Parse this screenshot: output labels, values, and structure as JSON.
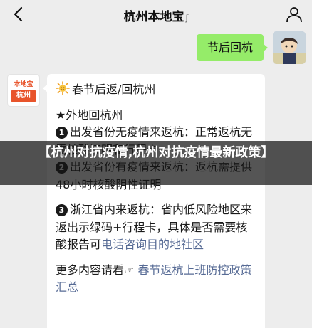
{
  "nav": {
    "title": "杭州本地宝",
    "title_icon": "ear-icon"
  },
  "my_message": {
    "text": "节后回杭"
  },
  "account": {
    "avatar_top": "本地宝",
    "avatar_bottom": "杭州"
  },
  "message": {
    "heading": "春节后返/回杭州",
    "section_title": "★外地回杭州",
    "item1_num": "1",
    "item1": "出发省份无疫情来返杭：正常返杭无需核酸证明和行程卡",
    "item2_num": "2",
    "item2": "出发省份有疫情来返杭：返杭需提供48小时核酸阴性证明",
    "item3_num": "3",
    "item3_plain": "浙江省内来返杭：省内低风险地区来返出示绿码+行程卡，具体是否需要核酸报告可",
    "item3_link": "电话咨询目的地社区",
    "more_plain": "更多内容请看☞ ",
    "more_link": "春节返杭上班防控政策汇总"
  },
  "overlay": {
    "caption": "【杭州对抗疫情,杭州对抗疫情最新政策】"
  },
  "colors": {
    "wechat_green": "#95ec69",
    "link_blue": "#576b95",
    "brand_orange": "#e8542b"
  }
}
